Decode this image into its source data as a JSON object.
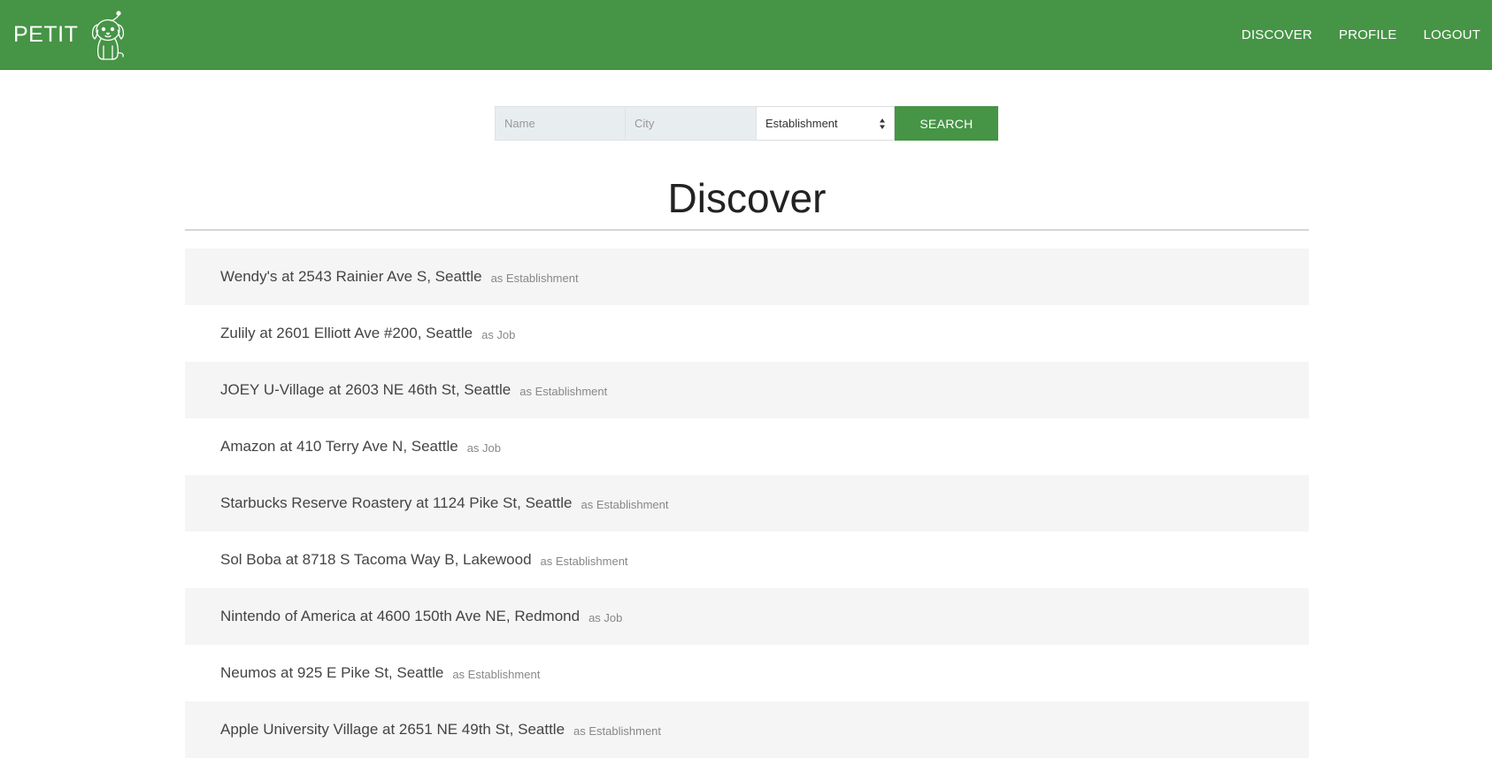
{
  "nav": {
    "brand": "PETIT",
    "links": [
      "DISCOVER",
      "PROFILE",
      "LOGOUT"
    ],
    "accent_color": "#469446"
  },
  "search": {
    "name_placeholder": "Name",
    "city_placeholder": "City",
    "type_selected": "Establishment",
    "button_label": "SEARCH"
  },
  "page_title": "Discover",
  "results": [
    {
      "label": "Wendy's at 2543 Rainier Ave S, Seattle",
      "type": "as Establishment"
    },
    {
      "label": "Zulily at 2601 Elliott Ave #200, Seattle",
      "type": "as Job"
    },
    {
      "label": "JOEY U-Village at 2603 NE 46th St, Seattle",
      "type": "as Establishment"
    },
    {
      "label": "Amazon at 410 Terry Ave N, Seattle",
      "type": "as Job"
    },
    {
      "label": "Starbucks Reserve Roastery at 1124 Pike St, Seattle",
      "type": "as Establishment"
    },
    {
      "label": "Sol Boba at 8718 S Tacoma Way B, Lakewood",
      "type": "as Establishment"
    },
    {
      "label": "Nintendo of America at 4600 150th Ave NE, Redmond",
      "type": "as Job"
    },
    {
      "label": "Neumos at 925 E Pike St, Seattle",
      "type": "as Establishment"
    },
    {
      "label": "Apple University Village at 2651 NE 49th St, Seattle",
      "type": "as Establishment"
    }
  ]
}
